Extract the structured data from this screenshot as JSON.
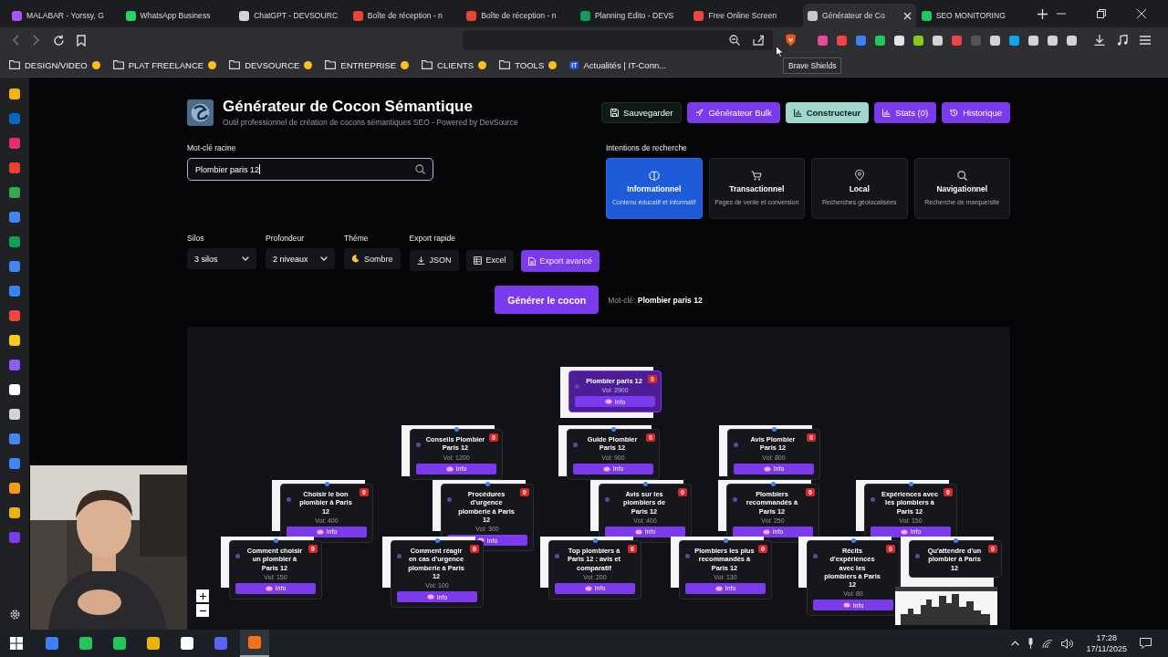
{
  "browser": {
    "tabs": [
      {
        "title": "MALABAR - Yorssy, G",
        "selected": false,
        "color": "#a855f7"
      },
      {
        "title": "WhatsApp Business",
        "selected": false,
        "color": "#25d366"
      },
      {
        "title": "ChatGPT - DEVSOURC",
        "selected": false,
        "color": "#d4d4d4"
      },
      {
        "title": "Boîte de réception - n",
        "selected": false,
        "color": "#ea4335"
      },
      {
        "title": "Boîte de réception - n",
        "selected": false,
        "color": "#ea4335"
      },
      {
        "title": "Planning Edito - DEVS",
        "selected": false,
        "color": "#0f9d58"
      },
      {
        "title": "Free Online Screen",
        "selected": false,
        "color": "#ef4444"
      },
      {
        "title": "Générateur de Co",
        "selected": true,
        "color": "#c8c8c8"
      },
      {
        "title": "SEO MONITORING",
        "selected": false,
        "color": "#22c55e"
      }
    ],
    "bookmarks": [
      {
        "label": "DESIGN/VIDEO",
        "kind": "folder"
      },
      {
        "label": "PLAT FREELANCE",
        "kind": "folder"
      },
      {
        "label": "DEVSOURCE",
        "kind": "folder"
      },
      {
        "label": "ENTREPRISE",
        "kind": "folder"
      },
      {
        "label": "CLIENTS",
        "kind": "folder"
      },
      {
        "label": "TOOLS",
        "kind": "folder"
      },
      {
        "label": "Actualités | IT-Conn...",
        "kind": "site",
        "logo": "IT"
      }
    ],
    "tooltip": "Brave Shields"
  },
  "app": {
    "header": {
      "title": "Générateur de Cocon Sémantique",
      "subtitle": "Outil professionnel de création de cocons sémantiques SEO - Powered by DevSource",
      "buttons": [
        {
          "label": "Sauvegarder",
          "kind": "save",
          "selected": false
        },
        {
          "label": "Générateur Bulk",
          "kind": "bulk",
          "selected": false
        },
        {
          "label": "Constructeur",
          "kind": "chart",
          "selected": true
        },
        {
          "label": "Stats (0)",
          "kind": "chart",
          "selected": false
        },
        {
          "label": "Historique",
          "kind": "history",
          "selected": false
        }
      ]
    },
    "keyword": {
      "label": "Mot-clé racine",
      "value": "Plombier paris 12"
    },
    "intentions": {
      "label": "Intentions de recherche",
      "items": [
        {
          "title": "Informationnel",
          "description": "Contenu éducatif et informatif",
          "selected": true
        },
        {
          "title": "Transactionnel",
          "description": "Pages de vente et conversion",
          "selected": false
        },
        {
          "title": "Local",
          "description": "Recherches géolocalisées",
          "selected": false
        },
        {
          "title": "Navigationnel",
          "description": "Recherche de marque/site",
          "selected": false
        }
      ]
    },
    "silos": {
      "label": "Silos",
      "value": "3 silos"
    },
    "depth": {
      "label": "Profondeur",
      "value": "2 niveaux"
    },
    "theme": {
      "label": "Thème",
      "value": "Sombre"
    },
    "export": {
      "label": "Export rapide",
      "buttons": [
        {
          "label": "JSON",
          "kind": "download"
        },
        {
          "label": "Excel",
          "kind": "table"
        },
        {
          "label": "Export avancé",
          "kind": "file"
        }
      ]
    },
    "generate": {
      "button": "Générer le cocon",
      "keyword": "Mot-clé: **Plombier paris 12**"
    },
    "tree": {
      "root": {
        "title": "Plombier paris 12",
        "badge": "0",
        "volume": "Vol: 2900",
        "info": "Info"
      },
      "level_1": [
        {
          "title": "Conseils Plombier Paris 12",
          "badge": "0",
          "volume": "Vol: 1200",
          "info": "Info"
        },
        {
          "title": "Guide Plombier Paris 12",
          "badge": "0",
          "volume": "Vol: 900",
          "info": "Info"
        },
        {
          "title": "Avis Plombier Paris 12",
          "badge": "0",
          "volume": "Vol: 800",
          "info": "Info"
        }
      ],
      "level_2": [
        {
          "title": "Choisir le bon plombier à Paris 12",
          "badge": "0",
          "volume": "Vol: 400",
          "info": "Info"
        },
        {
          "title": "Procédures d'urgence plomberie à Paris 12",
          "badge": "0",
          "volume": "Vol: 300",
          "info": "Info"
        },
        {
          "title": "Avis sur les plombiers de Paris 12",
          "badge": "0",
          "volume": "Vol: 400",
          "info": "Info"
        },
        {
          "title": "Plombiers recommandés à Paris 12",
          "badge": "0",
          "volume": "Vol: 250",
          "info": "Info"
        },
        {
          "title": "Expériences avec les plombiers à Paris 12",
          "badge": "0",
          "volume": "Vol: 150",
          "info": "Info"
        }
      ],
      "level_3": [
        {
          "title": "Comment choisir un plombier à Paris 12",
          "badge": "0",
          "volume": "Vol: 150",
          "info": "Info"
        },
        {
          "title": "Comment réagir en cas d'urgence plomberie à Paris 12",
          "badge": "0",
          "volume": "Vol: 100",
          "info": "Info"
        },
        {
          "title": "Top plombiers à Paris 12 : avis et comparatif",
          "badge": "0",
          "volume": "Vol: 200",
          "info": "Info"
        },
        {
          "title": "Plombiers les plus recommandés à Paris 12",
          "badge": "0",
          "volume": "Vol: 130",
          "info": "Info"
        },
        {
          "title": "Récits d'expériences avec les plombiers à Paris 12",
          "badge": "0",
          "volume": "Vol: 80",
          "info": "Info"
        },
        {
          "title": "Qu'attendre d'un plombier à Paris 12",
          "badge": "0"
        }
      ]
    }
  },
  "taskbar": {
    "time": "17:28",
    "date": "17/11/2025"
  }
}
